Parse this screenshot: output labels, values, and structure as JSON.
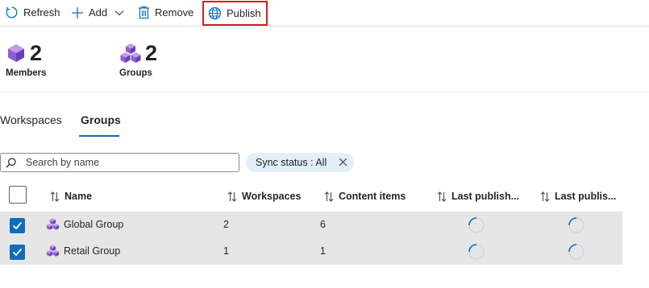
{
  "toolbar": {
    "refresh_label": "Refresh",
    "add_label": "Add",
    "remove_label": "Remove",
    "publish_label": "Publish",
    "highlight_color": "#d41f27"
  },
  "summary": {
    "members": {
      "count": "2",
      "label": "Members"
    },
    "groups": {
      "count": "2",
      "label": "Groups"
    }
  },
  "tabs": [
    {
      "label": "Workspaces",
      "selected": false
    },
    {
      "label": "Groups",
      "selected": true
    }
  ],
  "search": {
    "placeholder": "Search by name",
    "value": ""
  },
  "filter": {
    "label": "Sync status : All"
  },
  "table": {
    "columns": [
      "Name",
      "Workspaces",
      "Content items",
      "Last publish...",
      "Last publis..."
    ],
    "rows": [
      {
        "name": "Global Group",
        "workspaces": "2",
        "content_items": "6",
        "selected": true,
        "last_publish_1": "loading",
        "last_publish_2": "loading"
      },
      {
        "name": "Retail Group",
        "workspaces": "1",
        "content_items": "1",
        "selected": true,
        "last_publish_1": "loading",
        "last_publish_2": "loading"
      }
    ]
  },
  "colors": {
    "accent": "#0f6cbd",
    "selected_row": "#e6e6e6",
    "icon_purple": "#9b6fd6"
  }
}
